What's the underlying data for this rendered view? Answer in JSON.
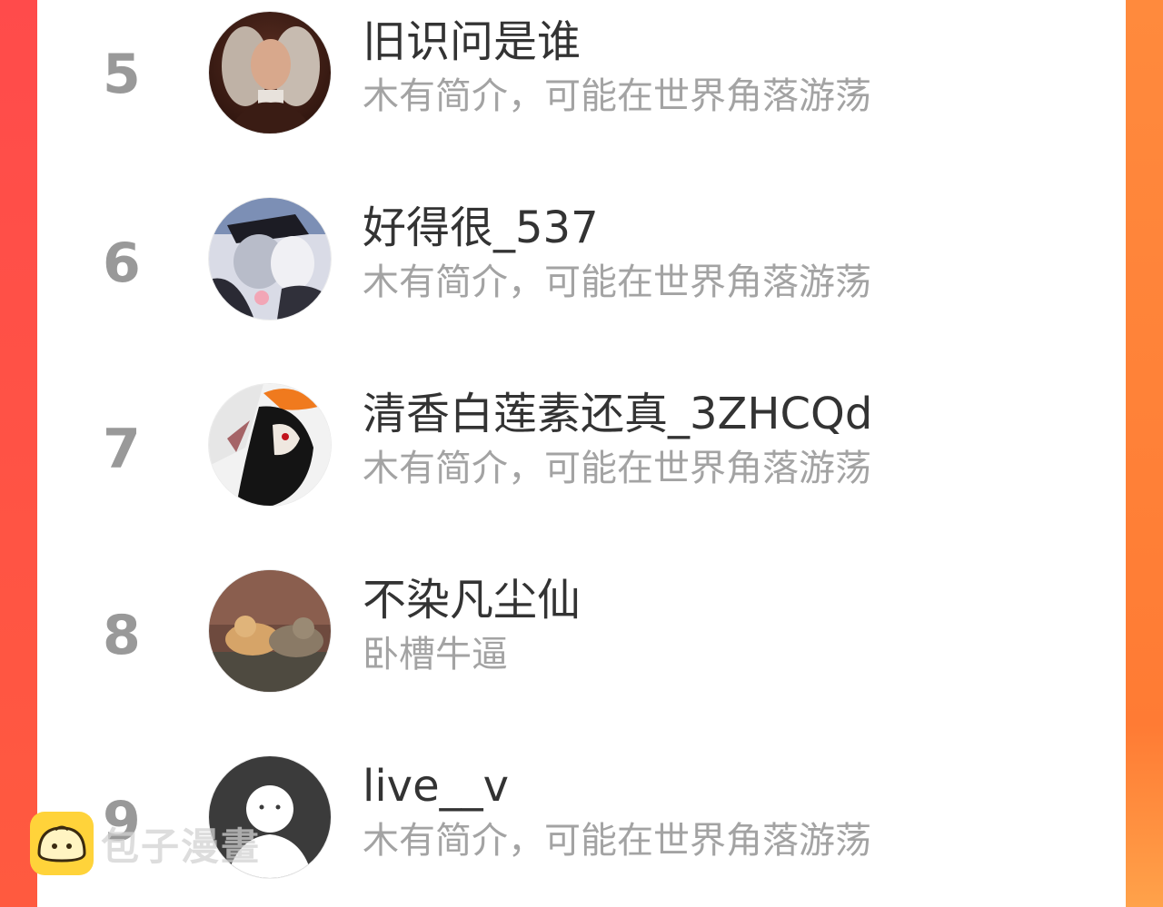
{
  "ranking": [
    {
      "rank": "5",
      "name": "旧识问是谁",
      "bio": "木有简介，可能在世界角落游荡",
      "avatar": "portrait-avatar"
    },
    {
      "rank": "6",
      "name": "好得很_537",
      "bio": "木有简介，可能在世界角落游荡",
      "avatar": "anime-couple-avatar"
    },
    {
      "rank": "7",
      "name": "清香白莲素还真_3ZHCQd",
      "bio": "木有简介，可能在世界角落游荡",
      "avatar": "anime-mask-avatar"
    },
    {
      "rank": "8",
      "name": "不染凡尘仙",
      "bio": "卧槽牛逼",
      "avatar": "cats-avatar"
    },
    {
      "rank": "9",
      "name": "live__v",
      "bio": "木有简介，可能在世界角落游荡",
      "avatar": "default-avatar"
    }
  ],
  "watermark": {
    "text": "包子漫畫",
    "icon": "bun-icon"
  },
  "colors": {
    "frame_left": "#ff4b4b",
    "frame_right": "#ff8a3d",
    "rank": "#999999",
    "name": "#333333",
    "bio": "#a3a3a3"
  }
}
